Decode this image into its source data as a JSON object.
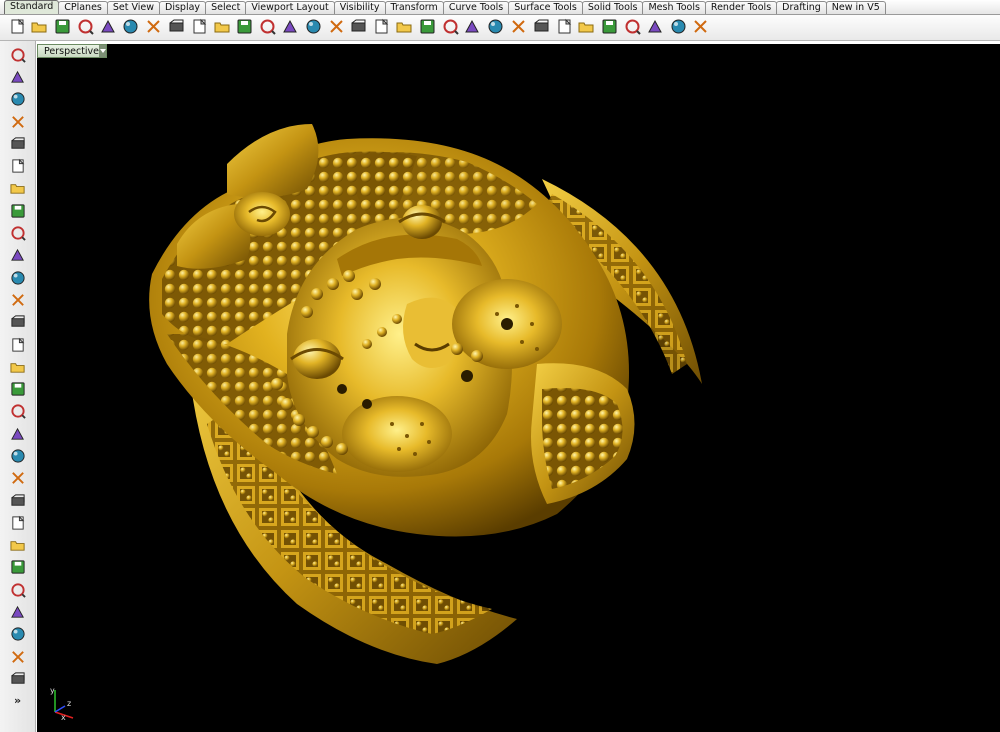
{
  "tabs": [
    {
      "id": "standard",
      "label": "Standard",
      "active": true
    },
    {
      "id": "cplanes",
      "label": "CPlanes"
    },
    {
      "id": "set-view",
      "label": "Set View"
    },
    {
      "id": "display",
      "label": "Display"
    },
    {
      "id": "select",
      "label": "Select"
    },
    {
      "id": "viewport-layout",
      "label": "Viewport Layout"
    },
    {
      "id": "visibility",
      "label": "Visibility"
    },
    {
      "id": "transform",
      "label": "Transform"
    },
    {
      "id": "curve-tools",
      "label": "Curve Tools"
    },
    {
      "id": "surface-tools",
      "label": "Surface Tools"
    },
    {
      "id": "solid-tools",
      "label": "Solid Tools"
    },
    {
      "id": "mesh-tools",
      "label": "Mesh Tools"
    },
    {
      "id": "render-tools",
      "label": "Render Tools"
    },
    {
      "id": "drafting",
      "label": "Drafting"
    },
    {
      "id": "new-in-v5",
      "label": "New in V5"
    }
  ],
  "toolbar_icons": [
    "new-file-icon",
    "open-folder-icon",
    "save-icon",
    "print-icon",
    "cut-icon",
    "copy-icon",
    "paste-icon",
    "undo-icon",
    "pan-hand-icon",
    "move-cross-icon",
    "zoom-icon",
    "zoom-window-icon",
    "zoom-extents-icon",
    "zoom-selected-icon",
    "rotate-view-icon",
    "four-viewports-icon",
    "cplane-red-icon",
    "hide-eye-icon",
    "show-objects-icon",
    "lock-icon",
    "light-bulb-icon",
    "layer-icon",
    "properties-icon",
    "color-wheel-icon",
    "render-sphere-icon",
    "environment-sphere-icon",
    "material-sphere-icon",
    "options-icon",
    "gear-settings-icon",
    "snap-grid-icon",
    "help-icon"
  ],
  "left_toolbar_icons": [
    "select-arrow-icon",
    "point-icon",
    "polyline-icon",
    "curve-icon",
    "circle-icon",
    "ellipse-icon",
    "arc-icon",
    "rectangle-icon",
    "polygon-icon",
    "fillet-icon",
    "surface-from-points-icon",
    "extrude-icon",
    "box-solid-icon",
    "sphere-icon",
    "cylinder-icon",
    "planar-surface-icon",
    "sweep-icon",
    "boolean-icon",
    "mesh-icon",
    "dimension-icon",
    "trim-icon",
    "split-icon",
    "join-icon",
    "offset-icon",
    "text-icon",
    "array-icon",
    "group-icon",
    "mirror-icon",
    "block-icon"
  ],
  "left_more_label": "»",
  "viewport": {
    "title": "Perspective",
    "axis_labels": {
      "x": "x",
      "y": "y",
      "z": "z"
    }
  },
  "colors": {
    "viewport_bg": "#000000",
    "model_gold": "#d4a518",
    "model_highlight": "#ffe36a",
    "model_shadow": "#5a3d00",
    "active_tab": "#dfe8d9"
  }
}
